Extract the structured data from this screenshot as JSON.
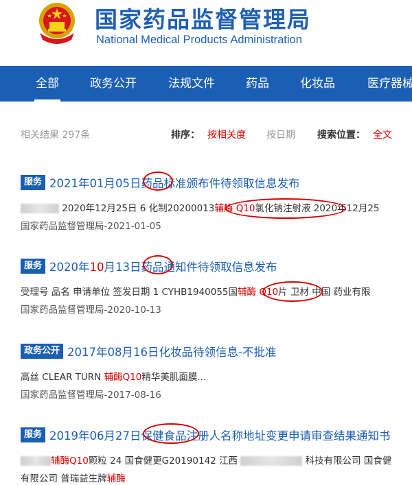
{
  "header": {
    "title": "国家药品监督管理局",
    "subtitle": "National Medical Products Administration",
    "emblem_icon": "national-emblem-icon"
  },
  "nav": {
    "items": [
      "全部",
      "政务公开",
      "法规文件",
      "药品",
      "化妆品",
      "医疗器械"
    ],
    "active_index": 0
  },
  "summary": {
    "count_text": "相关结果 297条",
    "sort_label": "排序：",
    "sort_relevance": "按相关度",
    "sort_date": "按日期",
    "scope_label": "搜索位置：",
    "scope_value": "全文"
  },
  "results": [
    {
      "badge": "服务",
      "title_a": "2021年01月05日",
      "title_hl": "",
      "title_b": "药品",
      "title_c": "标准颁布件待领取信息发布",
      "snippet_a": "2020年12月25日 6 化制20200013",
      "snippet_hl": "辅酶 Q10",
      "snippet_b": "氯化钠注射液 2020年12月25",
      "source": "国家药品监督管理局-2021-01-05"
    },
    {
      "badge": "服务",
      "title_a": "2020年",
      "title_hl": "10",
      "title_b": "月13日",
      "title_c": "药品通知件待领取信息发布",
      "snippet_a": "受理号 品名 申请单位 签发日期 1 CYHB1940055国",
      "snippet_hl": "辅酶 Q10",
      "snippet_b": "片 卫材 中国 药业有限",
      "source": "国家药品监督管理局-2020-10-13"
    },
    {
      "badge": "政务公开",
      "title_a": "2017年08月16日化妆品待领信息-不批准",
      "title_hl": "",
      "title_b": "",
      "title_c": "",
      "snippet_a": "高丝 CLEAR TURN ",
      "snippet_hl": "辅酶Q10",
      "snippet_b": "精华美肌面膜...",
      "source": "国家药品监督管理局-2017-08-16"
    },
    {
      "badge": "服务",
      "title_a": "2019年06月27日",
      "title_hl": "",
      "title_b": "保健食品",
      "title_c": "注册人名称地址变更申请审查结果通知书",
      "snippet_a": "",
      "snippet_hl": "辅酶Q10",
      "snippet_b": "颗粒 24 国食健更G20190142 江西",
      "snippet_c": "科技有限公司 国食健",
      "line3_a": "有限公司 普瑞益生牌",
      "line3_hl": "辅酶"
    }
  ],
  "colors": {
    "brand_blue": "#1b5fb4",
    "highlight_red": "#d40000"
  }
}
